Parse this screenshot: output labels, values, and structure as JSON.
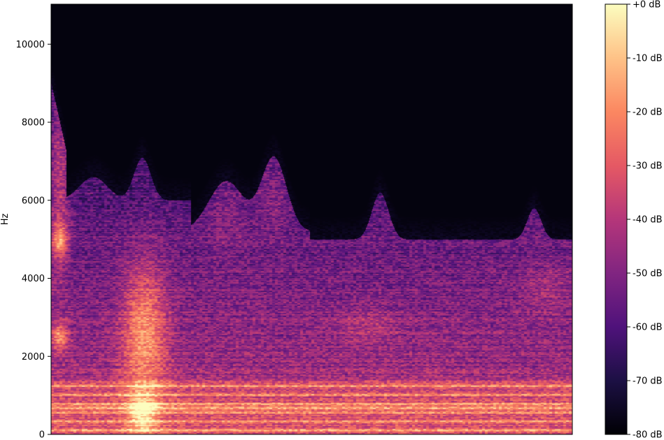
{
  "chart_data": {
    "type": "heatmap",
    "title": "",
    "xlabel": "",
    "ylabel": "Hz",
    "ylim": [
      0,
      11025
    ],
    "yticks": [
      {
        "value": 0,
        "label": "0"
      },
      {
        "value": 2000,
        "label": "2000"
      },
      {
        "value": 4000,
        "label": "4000"
      },
      {
        "value": 6000,
        "label": "6000"
      },
      {
        "value": 8000,
        "label": "8000"
      },
      {
        "value": 10000,
        "label": "10000"
      }
    ],
    "colormap": "magma",
    "colormap_stops": [
      "#000004",
      "#1c1044",
      "#4f127b",
      "#812581",
      "#b5367a",
      "#e55964",
      "#fb8761",
      "#fec287",
      "#fcfdbf"
    ],
    "colorbar": {
      "range": [
        -80,
        0
      ],
      "ticks": [
        {
          "value": 0,
          "label": "+0 dB"
        },
        {
          "value": -10,
          "label": "-10 dB"
        },
        {
          "value": -20,
          "label": "-20 dB"
        },
        {
          "value": -30,
          "label": "-30 dB"
        },
        {
          "value": -40,
          "label": "-40 dB"
        },
        {
          "value": -50,
          "label": "-50 dB"
        },
        {
          "value": -60,
          "label": "-60 dB"
        },
        {
          "value": -70,
          "label": "-70 dB"
        },
        {
          "value": -80,
          "label": "-80 dB"
        }
      ]
    },
    "grid": false,
    "legend": "colorbar-right"
  }
}
